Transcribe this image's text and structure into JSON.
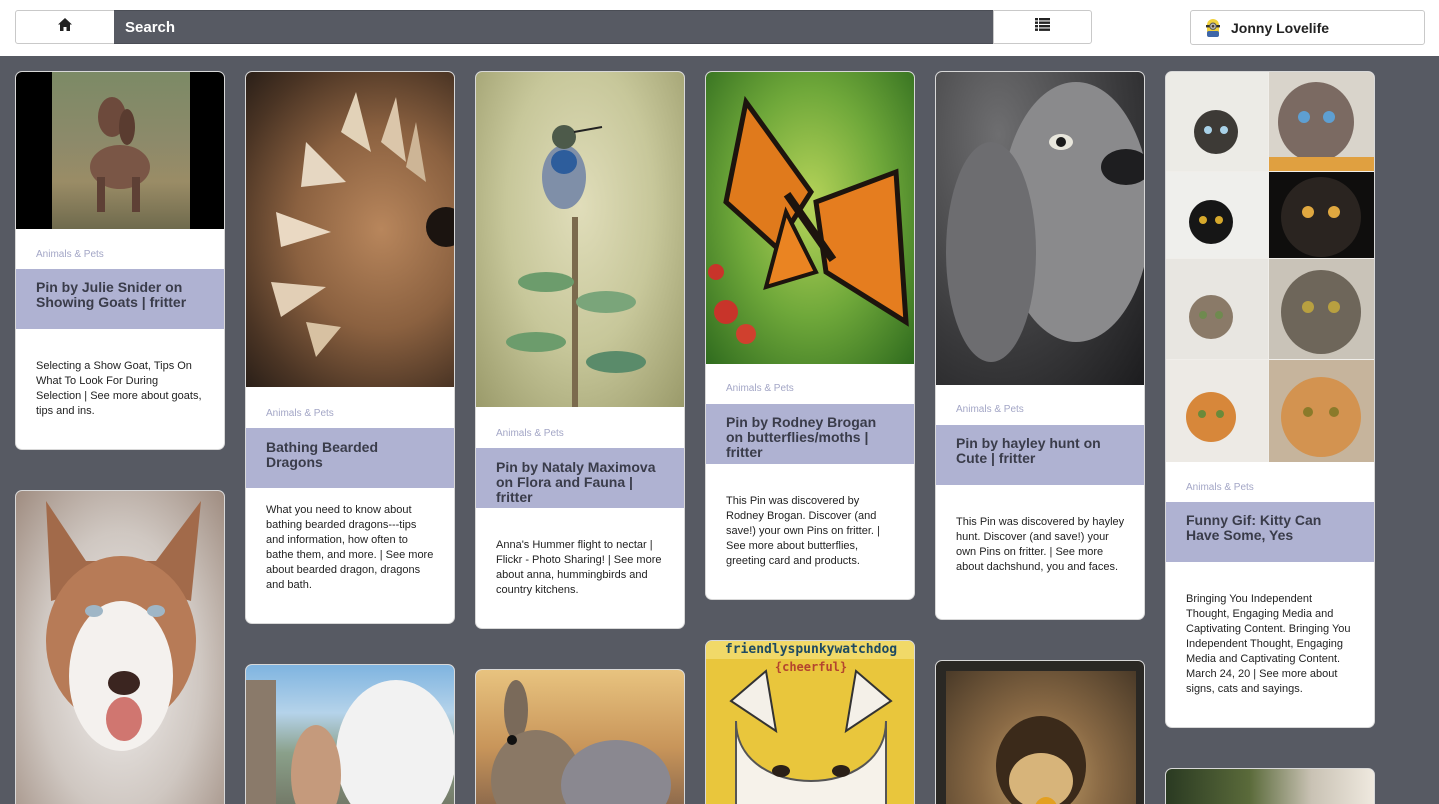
{
  "header": {
    "search_label": "Search",
    "user_name": "Jonny Lovelife",
    "home_icon": "home-icon",
    "list_icon": "list-icon",
    "avatar_icon": "minion-avatar"
  },
  "pins": [
    {
      "category": "Animals & Pets",
      "title": "Pin by Julie Snider on Showing Goats | fritter",
      "description": "Selecting a Show Goat, Tips On What To Look For During Selection | See more about goats, tips and ins."
    },
    {
      "category": "Animals & Pets",
      "title": "Bathing Bearded Dragons",
      "description": "What you need to know about bathing bearded dragons---tips and information, how often to bathe them, and more. | See more about bearded dragon, dragons and bath."
    },
    {
      "category": "Animals & Pets",
      "title": "Pin by Nataly Maximova on Flora and Fauna | fritter",
      "description": "Anna's Hummer flight to nectar | Flickr - Photo Sharing! | See more about anna, hummingbirds and country kitchens."
    },
    {
      "category": "Animals & Pets",
      "title": "Pin by Rodney Brogan on butterflies/moths | fritter",
      "description": "This Pin was discovered by Rodney Brogan. Discover (and save!) your own Pins on fritter. | See more about butterflies, greeting card and products."
    },
    {
      "category": "Animals & Pets",
      "title": "Pin by hayley hunt on Cute | fritter",
      "description": "This Pin was discovered by hayley hunt. Discover (and save!) your own Pins on fritter. | See more about dachshund, you and faces."
    },
    {
      "category": "Animals & Pets",
      "title": "Funny Gif: Kitty Can Have Some, Yes",
      "description": "Bringing You Independent Thought, Engaging Media and Captivating Content. Bringing You Independent Thought, Engaging Media and Captivating Content. March 24, 20 | See more about signs, cats and sayings."
    }
  ],
  "image_captions": {
    "painting_top": "friendlyspunkywatchdog",
    "painting_sub": "{cheerful}"
  }
}
